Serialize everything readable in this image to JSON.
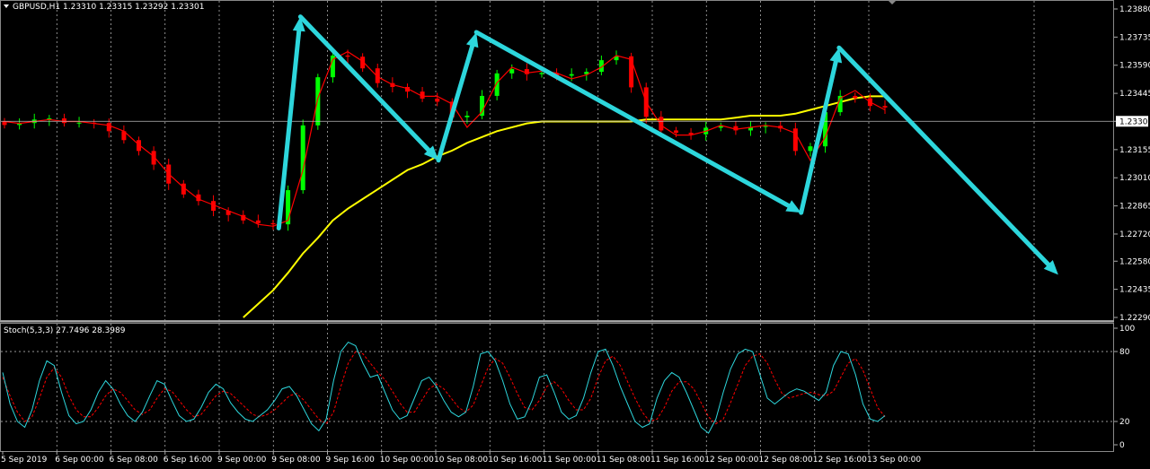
{
  "header": {
    "symbol": "GBPUSD,H1",
    "ohlc": "1.23310 1.23315 1.23292 1.23301"
  },
  "stoch_header": "Stoch(5,3,3) 27.7496 28.3989",
  "colors": {
    "bull": "#00ff00",
    "bear": "#ff0000",
    "ma_fast": "#ff0000",
    "ma_slow": "#ffff00",
    "arrow": "#2dd6dc",
    "stoch_main": "#2dd6dc",
    "stoch_signal": "#ff0000",
    "grid": "#c8c8c8"
  },
  "chart_data": [
    {
      "type": "candlestick",
      "symbol": "GBPUSD",
      "timeframe": "H1",
      "current_price": "1.23301",
      "y_ticks": [
        "1.23880",
        "1.23735",
        "1.23590",
        "1.23445",
        "1.23301",
        "1.23155",
        "1.23010",
        "1.22865",
        "1.22720",
        "1.22580",
        "1.22435",
        "1.22290"
      ],
      "ylim": [
        1.2229,
        1.2388
      ],
      "x_ticks": [
        "5 Sep 2019",
        "6 Sep 00:00",
        "6 Sep 08:00",
        "6 Sep 16:00",
        "9 Sep 00:00",
        "9 Sep 08:00",
        "9 Sep 16:00",
        "10 Sep 00:00",
        "10 Sep 08:00",
        "10 Sep 16:00",
        "11 Sep 00:00",
        "11 Sep 08:00",
        "11 Sep 16:00",
        "12 Sep 00:00",
        "12 Sep 08:00",
        "12 Sep 16:00",
        "13 Sep 00:00"
      ],
      "ma_fast_close": [
        1.233,
        1.2329,
        1.233,
        1.2331,
        1.233,
        1.233,
        1.2329,
        1.2328,
        1.2325,
        1.2318,
        1.2312,
        1.2303,
        1.2296,
        1.229,
        1.2287,
        1.2284,
        1.2281,
        1.2277,
        1.2276,
        1.2279,
        1.2305,
        1.2342,
        1.2362,
        1.2366,
        1.2361,
        1.2353,
        1.2349,
        1.2347,
        1.2343,
        1.2343,
        1.2339,
        1.2327,
        1.2335,
        1.235,
        1.2358,
        1.2355,
        1.2356,
        1.2355,
        1.2352,
        1.2354,
        1.2358,
        1.2364,
        1.2362,
        1.234,
        1.2328,
        1.2323,
        1.2323,
        1.2325,
        1.2328,
        1.2326,
        1.2327,
        1.2328,
        1.2327,
        1.2324,
        1.231,
        1.2322,
        1.2342,
        1.2346,
        1.234,
        1.2336
      ],
      "ma_slow_close": [
        null,
        null,
        null,
        null,
        null,
        null,
        null,
        null,
        null,
        null,
        null,
        null,
        null,
        null,
        null,
        null,
        1.2229,
        1.2236,
        1.2243,
        1.2252,
        1.2262,
        1.227,
        1.2279,
        1.2285,
        1.229,
        1.2295,
        1.23,
        1.2305,
        1.2308,
        1.2312,
        1.2315,
        1.2319,
        1.2322,
        1.2325,
        1.2327,
        1.2329,
        1.233,
        1.233,
        1.233,
        1.233,
        1.233,
        1.233,
        1.233,
        1.2331,
        1.2331,
        1.2331,
        1.2331,
        1.2331,
        1.2331,
        1.2332,
        1.2333,
        1.2333,
        1.2333,
        1.2334,
        1.2336,
        1.2338,
        1.234,
        1.2342,
        1.2343,
        1.2343
      ],
      "arrows": [
        {
          "from": [
            5.1,
            1.2275
          ],
          "to": [
            5.5,
            1.2384
          ]
        },
        {
          "from": [
            5.5,
            1.2384
          ],
          "to": [
            8.05,
            1.231
          ]
        },
        {
          "from": [
            8.05,
            1.231
          ],
          "to": [
            8.75,
            1.2376
          ]
        },
        {
          "from": [
            8.75,
            1.2376
          ],
          "to": [
            14.75,
            1.2283
          ]
        },
        {
          "from": [
            14.75,
            1.2283
          ],
          "to": [
            15.45,
            1.2368
          ]
        },
        {
          "from": [
            15.45,
            1.2368
          ],
          "to": [
            19.5,
            1.2251
          ]
        }
      ]
    },
    {
      "type": "line",
      "name": "Stoch(5,3,3)",
      "levels": [
        "100",
        "80",
        "20",
        "0"
      ],
      "ylim": [
        0,
        100
      ],
      "main": [
        62,
        35,
        20,
        15,
        30,
        55,
        72,
        68,
        45,
        25,
        18,
        20,
        30,
        45,
        55,
        48,
        35,
        25,
        20,
        28,
        42,
        55,
        52,
        38,
        25,
        20,
        22,
        32,
        45,
        52,
        48,
        36,
        28,
        22,
        20,
        25,
        30,
        38,
        48,
        50,
        42,
        30,
        18,
        12,
        22,
        55,
        80,
        88,
        85,
        70,
        58,
        60,
        45,
        30,
        22,
        25,
        40,
        55,
        58,
        50,
        38,
        28,
        24,
        28,
        50,
        78,
        80,
        72,
        55,
        35,
        22,
        24,
        38,
        58,
        60,
        45,
        28,
        22,
        25,
        40,
        62,
        80,
        82,
        68,
        50,
        35,
        20,
        15,
        18,
        40,
        55,
        62,
        58,
        45,
        30,
        15,
        10,
        22,
        45,
        65,
        78,
        82,
        80,
        60,
        40,
        35,
        40,
        45,
        48,
        46,
        42,
        38,
        45,
        68,
        80,
        78,
        60,
        35,
        22,
        20,
        25
      ],
      "signal": [
        58,
        42,
        28,
        20,
        24,
        40,
        58,
        66,
        58,
        42,
        30,
        24,
        24,
        32,
        42,
        48,
        45,
        38,
        30,
        26,
        30,
        40,
        48,
        46,
        38,
        30,
        24,
        26,
        34,
        42,
        46,
        44,
        38,
        32,
        26,
        24,
        26,
        30,
        36,
        42,
        44,
        38,
        30,
        22,
        18,
        28,
        50,
        70,
        80,
        78,
        70,
        62,
        56,
        46,
        36,
        28,
        28,
        38,
        48,
        52,
        48,
        40,
        32,
        28,
        34,
        50,
        66,
        74,
        70,
        58,
        44,
        32,
        30,
        38,
        50,
        54,
        48,
        38,
        30,
        30,
        40,
        58,
        72,
        76,
        68,
        54,
        40,
        28,
        20,
        22,
        32,
        46,
        54,
        54,
        48,
        36,
        24,
        18,
        22,
        36,
        52,
        68,
        76,
        78,
        70,
        56,
        44,
        40,
        42,
        44,
        45,
        43,
        42,
        46,
        58,
        70,
        74,
        64,
        48,
        32,
        24
      ],
      "current_main": "27.7496",
      "current_signal": "28.3989"
    }
  ]
}
